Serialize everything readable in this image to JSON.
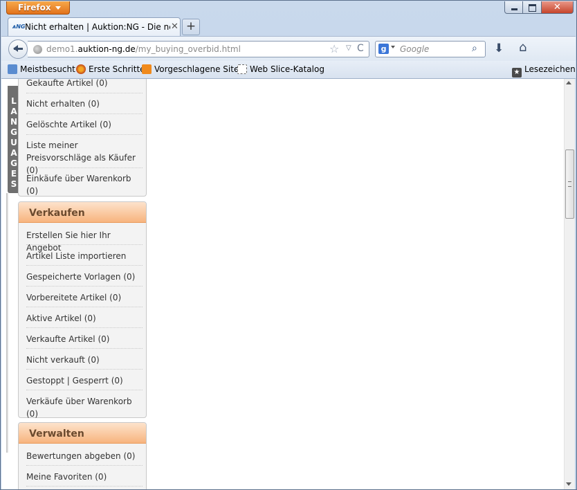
{
  "window": {
    "app_menu_label": "Firefox",
    "close_glyph": "✕"
  },
  "tabs": [
    {
      "favicon_text": "ᴀNG",
      "label": "Nicht erhalten | Auktion:NG - Die neue G...",
      "close_glyph": "✕"
    }
  ],
  "new_tab_glyph": "+",
  "navbar": {
    "url_prefix": "demo1.",
    "url_host": "auktion-ng.de",
    "url_path": "/my_buying_overbid.html",
    "star_glyph": "☆",
    "dropdown_glyph": "▽",
    "reload_glyph": "C",
    "search_engine_letter": "g",
    "search_placeholder": "Google",
    "search_glyph": "⌕",
    "download_glyph": "⬇",
    "home_glyph": "⌂"
  },
  "bookmarks": {
    "items": [
      {
        "label": "Meistbesucht",
        "icon": "most-visited-icon"
      },
      {
        "label": "Erste Schritte",
        "icon": "firefox-icon"
      },
      {
        "label": "Vorgeschlagene Sites",
        "icon": "suggested-sites-icon"
      },
      {
        "label": "Web Slice-Katalog",
        "icon": "web-slice-icon"
      }
    ],
    "right_label": "Lesezeichen",
    "right_glyph": "★"
  },
  "languages_tab": [
    "L",
    "A",
    "N",
    "G",
    "U",
    "A",
    "G",
    "E",
    "S"
  ],
  "sidebar": {
    "kaufen_items": [
      "Gekaufte Artikel (0)",
      "Nicht erhalten (0)",
      "Gelöschte Artikel (0)",
      "Liste meiner Preisvorschläge als Käufer (0)",
      "Einkäufe über Warenkorb (0)"
    ],
    "verkaufen": {
      "title": "Verkaufen",
      "items": [
        "Erstellen Sie hier Ihr Angebot",
        "Artikel Liste importieren",
        "Gespeicherte Vorlagen (0)",
        "Vorbereitete Artikel (0)",
        "Aktive Artikel (0)",
        "Verkaufte Artikel (0)",
        "Nicht verkauft (0)",
        "Gestoppt | Gesperrt (0)",
        "Verkäufe über Warenkorb (0)"
      ]
    },
    "verwalten": {
      "title": "Verwalten",
      "items": [
        "Bewertungen abgeben (0)",
        "Meine Favoriten (0)"
      ]
    }
  }
}
